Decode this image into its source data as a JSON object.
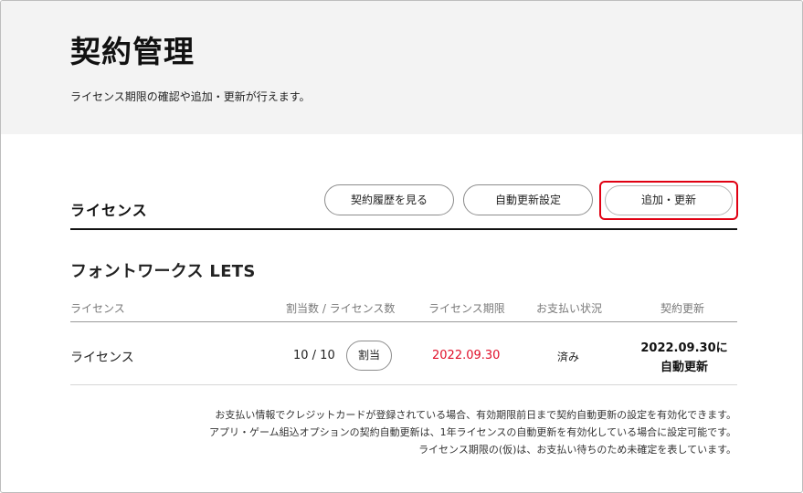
{
  "page": {
    "title": "契約管理",
    "description": "ライセンス期限の確認や追加・更新が行えます。"
  },
  "section": {
    "title": "ライセンス",
    "buttons": {
      "history": "契約履歴を見る",
      "auto_renew_settings": "自動更新設定",
      "add_renew": "追加・更新"
    },
    "highlight_color": "#e00012"
  },
  "product": {
    "name": "フォントワークス LETS",
    "table": {
      "headers": {
        "license": "ライセンス",
        "allocation": "割当数 / ライセンス数",
        "period": "ライセンス期限",
        "payment": "お支払い状況",
        "renewal": "契約更新"
      },
      "rows": [
        {
          "license": "ライセンス",
          "allocation": "10 / 10",
          "allocate_button": "割当",
          "period": "2022.09.30",
          "payment": "済み",
          "renewal_date": "2022.09.30に",
          "renewal_type": "自動更新"
        }
      ]
    }
  },
  "notes": [
    "お支払い情報でクレジットカードが登録されている場合、有効期限前日まで契約自動更新の設定を有効化できます。",
    "アプリ・ゲーム組込オプションの契約自動更新は、1年ライセンスの自動更新を有効化している場合に設定可能です。",
    "ライセンス期限の(仮)は、お支払い待ちのため未確定を表しています。"
  ],
  "colors": {
    "expiry_date": "#e0102a",
    "header_background": "#f3f3f3"
  }
}
